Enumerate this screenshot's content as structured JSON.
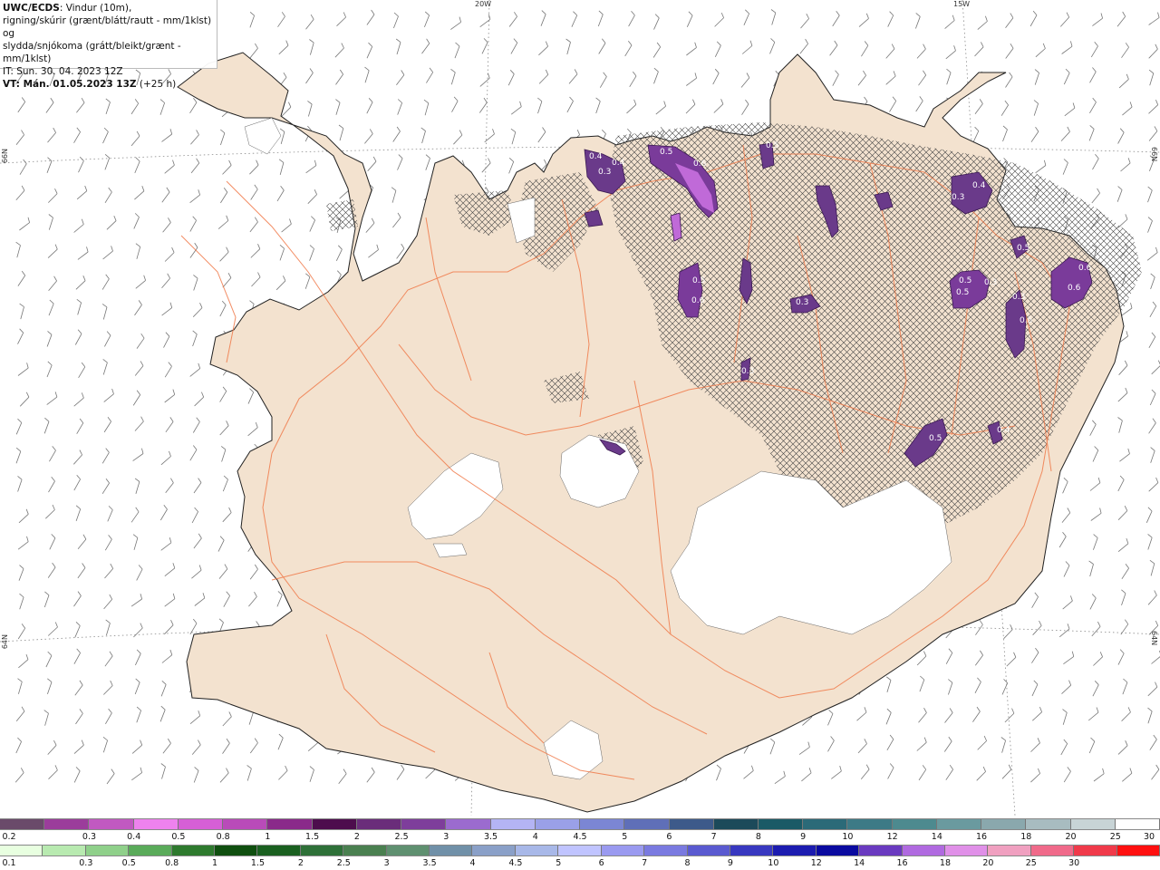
{
  "header": {
    "model": "UWC/ECDS",
    "line1_rest": ": Vindur (10m),",
    "line2": "rigning/skúrir (grænt/blátt/rautt - mm/1klst) og",
    "line3": "slydda/snjókoma (grátt/bleikt/grænt - mm/1klst)",
    "line4": "IT: Sun. 30. 04. 2023 12Z",
    "line5_bold": "VT: Mán. 01.05.2023 13Z",
    "line5_rest": " (+25 h)"
  },
  "grid_labels": {
    "lon_20w": "20W",
    "lon_15w": "15W",
    "lat_66n_left": "66N",
    "lat_66n_right": "66N",
    "lat_64n_left": "64N",
    "lat_64n_right": "64N"
  },
  "colors": {
    "land": "#f3e2cf",
    "coast": "#222222",
    "roads": "#f07a4a",
    "glacier": "#ffffff",
    "precip_dark": "#5b2d7a",
    "precip_light": "#c06ad8",
    "barb": "#666666"
  },
  "precip_labels": [
    "0.5",
    "0.4",
    "0.6",
    "0.3",
    "0.4",
    "0.5",
    "0.5",
    "0.6",
    "0.3",
    "0.5",
    "0.3",
    "0.6",
    "0.5",
    "0.5",
    "0.3",
    "0.3",
    "0.5",
    "0.4",
    "0.6",
    "0.5",
    "0.4",
    "0.3"
  ],
  "legend_top": {
    "swatch_colors": [
      "#6a4a6a",
      "#9b3d9b",
      "#c159c1",
      "#ee82ee",
      "#d65fd6",
      "#b94bb9",
      "#8a2a8a",
      "#4d0d4d",
      "#6a2d7a",
      "#7e3e9b",
      "#9b6bcf",
      "#b4b4f4",
      "#9aa0e8",
      "#7b86d4",
      "#5f6fb8",
      "#3d5a8a",
      "#1c4a5a",
      "#1a5a66",
      "#2b6a78",
      "#3d7a86",
      "#4d8a8f",
      "#6a9a9f",
      "#8aa8ad",
      "#a8bcc0",
      "#c8d4d6",
      "#ffffff"
    ],
    "labels": [
      "0.2",
      "0.3",
      "0.4",
      "0.5",
      "0.8",
      "1",
      "1.5",
      "2",
      "2.5",
      "3",
      "3.5",
      "4",
      "4.5",
      "5",
      "6",
      "7",
      "8",
      "9",
      "10",
      "12",
      "14",
      "16",
      "18",
      "20",
      "25",
      "30"
    ]
  },
  "legend_bottom": {
    "swatch_colors": [
      "#e8ffe0",
      "#b8eab0",
      "#8fd08a",
      "#5aab5a",
      "#2e7a2e",
      "#0f4f0f",
      "#1a6020",
      "#2e7038",
      "#4a8050",
      "#5f9070",
      "#7090a8",
      "#8aa0c8",
      "#a8b8e8",
      "#c0c4ff",
      "#9a9af0",
      "#7a7ae0",
      "#5a5ad0",
      "#3838c0",
      "#1c1cb0",
      "#0a0aa0",
      "#6a3ac0",
      "#b06ae0",
      "#e090e8",
      "#f0a0c0",
      "#f06a8a",
      "#f03a4a",
      "#ff1010"
    ],
    "labels": [
      "0.1",
      "0.3",
      "0.5",
      "0.8",
      "1",
      "1.5",
      "2",
      "2.5",
      "3",
      "3.5",
      "4",
      "4.5",
      "5",
      "6",
      "7",
      "8",
      "9",
      "10",
      "12",
      "14",
      "16",
      "18",
      "20",
      "25",
      "30"
    ]
  }
}
